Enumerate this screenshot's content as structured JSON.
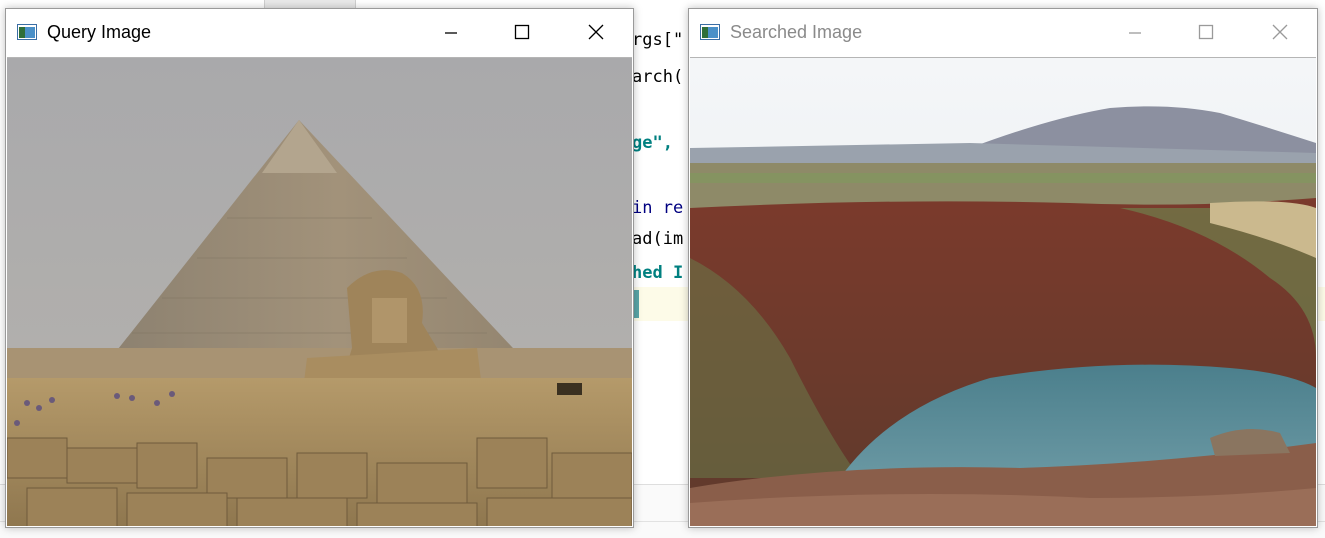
{
  "windows": {
    "query": {
      "title": "Query Image",
      "state": "active",
      "icon": "app-window-icon"
    },
    "searched": {
      "title": "Searched Image",
      "state": "inactive",
      "icon": "app-window-icon"
    }
  },
  "controls": {
    "minimize_icon": "minimize-icon",
    "maximize_icon": "maximize-icon",
    "close_icon": "close-icon"
  },
  "code_fragments": [
    {
      "text": "rgs[\"",
      "color": "#000000"
    },
    {
      "text": "arch(",
      "color": "#000000"
    },
    {
      "text": "ge\",",
      "color": "#008080"
    },
    {
      "text": "in re",
      "color": "#000080"
    },
    {
      "text": "ad(im",
      "color": "#000000"
    },
    {
      "text": "hed I",
      "color": "#008080"
    }
  ],
  "images": {
    "query": "pyramid-and-sphinx-photo",
    "searched": "crater-lake-photo"
  },
  "colors": {
    "title_active": "#000000",
    "title_inactive": "#8a8a8a",
    "window_border": "#9a9a9a"
  }
}
